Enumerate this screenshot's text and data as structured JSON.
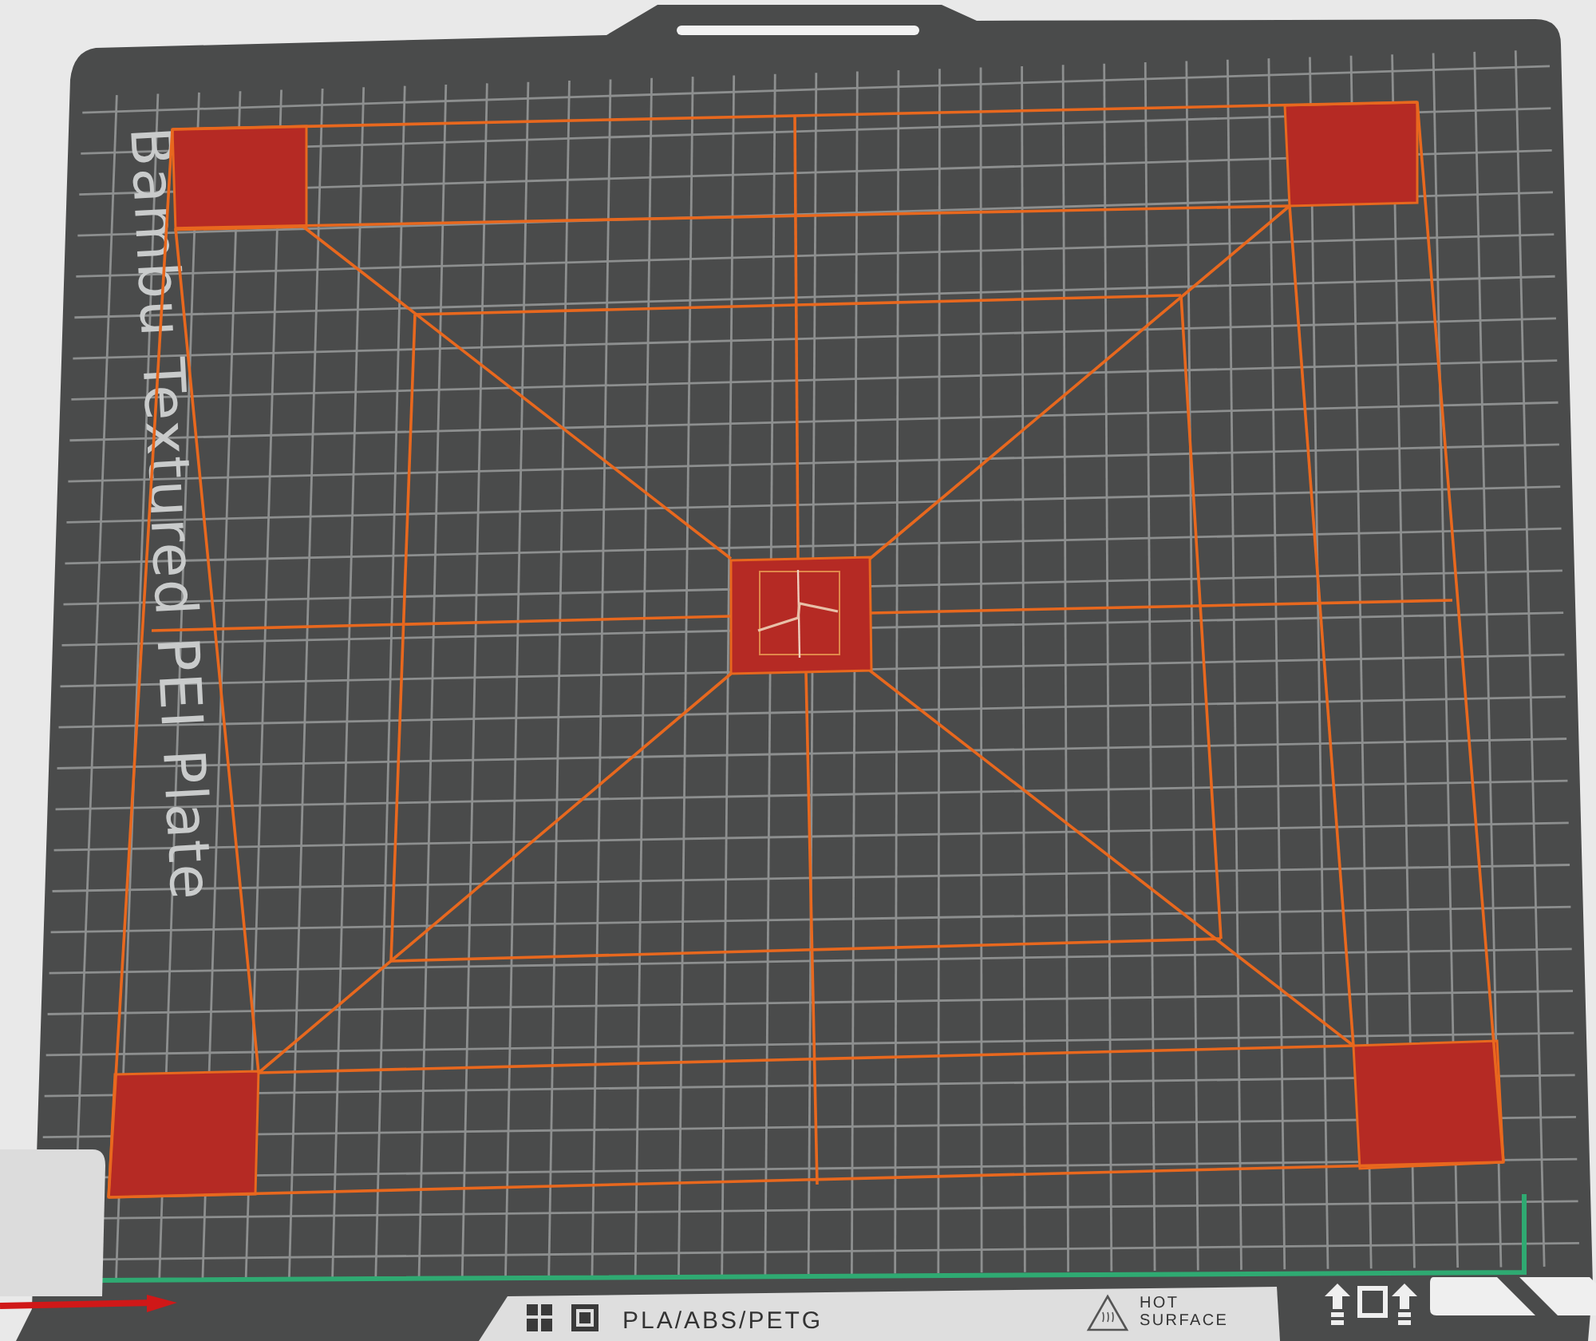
{
  "plate": {
    "label": "Bambu Textured PEI Plate"
  },
  "label_strip": {
    "filament": "PLA/ABS/PETG",
    "warning": [
      "HOT",
      "SURFACE"
    ]
  }
}
